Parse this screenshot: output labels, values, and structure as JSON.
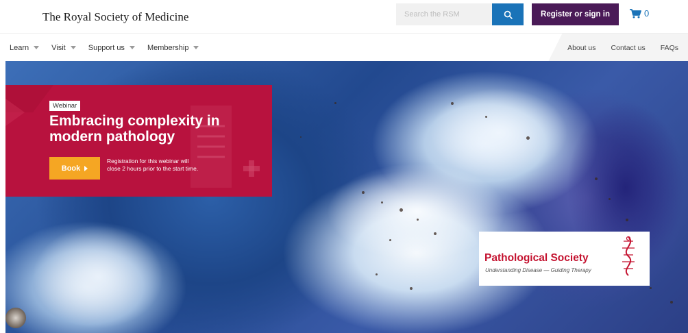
{
  "header": {
    "logo": "The Royal Society of Medicine",
    "search_placeholder": "Search the RSM",
    "register_label": "Register or sign in",
    "cart_count": "0"
  },
  "nav": {
    "left": [
      "Learn",
      "Visit",
      "Support us",
      "Membership"
    ],
    "right": [
      "About us",
      "Contact us",
      "FAQs"
    ]
  },
  "hero": {
    "tag": "Webinar",
    "title": "Embracing complexity in modern pathology",
    "book_label": "Book",
    "note": "Registration for this webinar will close 2 hours prior to the start time.",
    "partner_name": "Pathological Society",
    "partner_tagline": "Understanding Disease — Guiding Therapy"
  },
  "colors": {
    "accent_blue": "#1a73b8",
    "register_purple": "#4a1a57",
    "promo_red": "#b8123e",
    "book_orange": "#f5a623",
    "partner_red": "#c4122f"
  }
}
